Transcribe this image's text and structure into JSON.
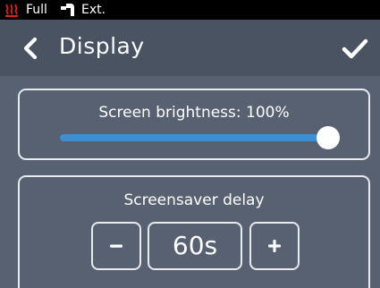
{
  "statusbar": {
    "heat_icon": "heater-icon",
    "heat_color": "#e02020",
    "mode_label": "Full",
    "filament_icon": "filament-sensor-icon",
    "source_label": "Ext."
  },
  "header": {
    "title": "Display",
    "back_icon": "chevron-left-icon",
    "confirm_icon": "checkmark-icon"
  },
  "brightness": {
    "label": "Screen brightness: 100%",
    "value_percent": 100,
    "accent_color": "#3f8fd0"
  },
  "screensaver": {
    "label": "Screensaver delay",
    "decrement_icon": "minus-icon",
    "value": "60s",
    "increment_icon": "plus-icon"
  },
  "colors": {
    "statusbar_bg": "#000000",
    "header_bg": "#4a5361",
    "content_bg": "#586171",
    "border": "#e8eaee"
  }
}
